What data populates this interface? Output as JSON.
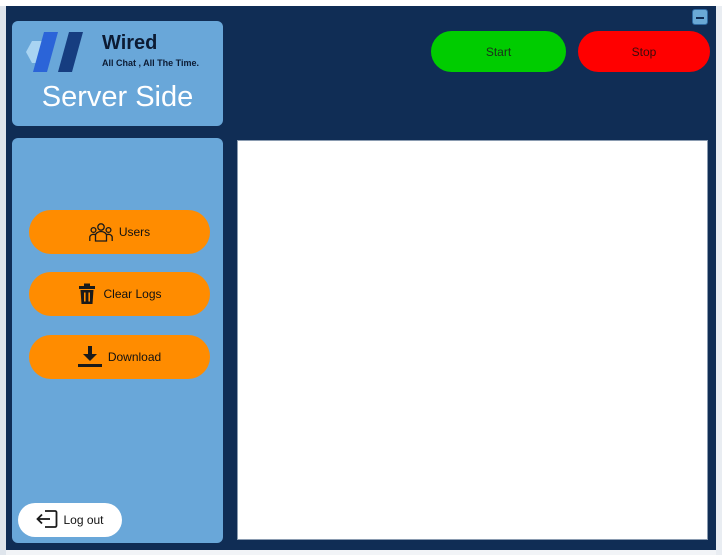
{
  "window": {
    "minimize_icon": "minimize-icon"
  },
  "brand": {
    "name": "Wired",
    "tagline": "All Chat , All The Time.",
    "logo_icon": "wired-logo",
    "title": "Server Side"
  },
  "controls": {
    "start_label": "Start",
    "stop_label": "Stop"
  },
  "sidebar": {
    "items": [
      {
        "label": "Users",
        "icon": "users-icon"
      },
      {
        "label": "Clear Logs",
        "icon": "trash-icon"
      },
      {
        "label": "Download",
        "icon": "download-icon"
      }
    ],
    "logout_label": "Log out",
    "logout_icon": "logout-icon"
  },
  "colors": {
    "app_background": "#102d55",
    "panel": "#69a7d9",
    "start": "#00cc00",
    "stop": "#ff0000",
    "action": "#ff8c00"
  }
}
